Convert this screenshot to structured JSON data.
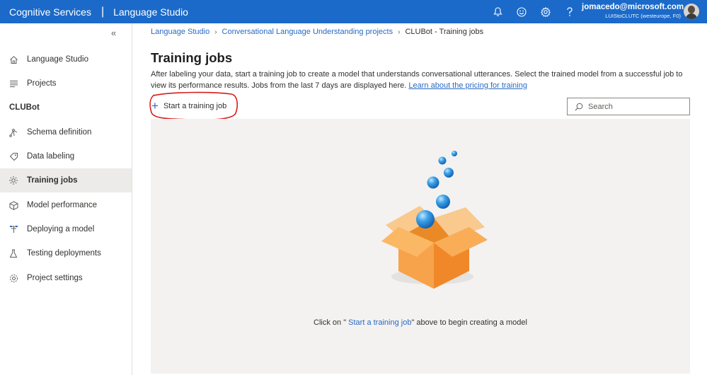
{
  "header": {
    "brand": "Cognitive Services",
    "separator": "|",
    "product": "Language Studio",
    "user_name": "jomacedo@microsoft.com",
    "user_sub": "LUIStoCLUTC (westeurope, F0)",
    "icons": [
      "bell-icon",
      "smiley-icon",
      "gear-icon",
      "help-icon"
    ]
  },
  "sidebar": {
    "collapse_glyph": "«",
    "top_items": [
      {
        "label": "Language Studio",
        "icon": "home-icon"
      },
      {
        "label": "Projects",
        "icon": "list-icon"
      }
    ],
    "section": "CLUBot",
    "items": [
      {
        "label": "Schema definition",
        "icon": "schema-icon"
      },
      {
        "label": "Data labeling",
        "icon": "tag-icon"
      },
      {
        "label": "Training jobs",
        "icon": "training-icon"
      },
      {
        "label": "Model performance",
        "icon": "cube-icon"
      },
      {
        "label": "Deploying a model",
        "icon": "deploy-icon"
      },
      {
        "label": "Testing deployments",
        "icon": "flask-icon"
      },
      {
        "label": "Project settings",
        "icon": "settings-icon"
      }
    ],
    "active": "Training jobs"
  },
  "breadcrumb": {
    "items": [
      "Language Studio",
      "Conversational Language Understanding projects"
    ],
    "current": "CLUBot - Training jobs",
    "chevron": "›"
  },
  "main": {
    "title": "Training jobs",
    "description": "After labeling your data, start a training job to create a model that understands conversational utterances. Select the trained model from a successful job to view its performance results. Jobs from the last 7 days are displayed here.",
    "learn_link": "Learn about the pricing for training",
    "start_button": "Start a training job",
    "search_placeholder": "Search",
    "empty_prefix": "Click on \"",
    "empty_link": " Start a training job",
    "empty_suffix": "\" above to begin creating a model"
  },
  "colors": {
    "topbar": "#1b6ac9",
    "link": "#2a6ac2",
    "annotation": "#d91c1c",
    "box_orange": "#f7a34b",
    "bubble_blue": "#3aa0e6"
  }
}
